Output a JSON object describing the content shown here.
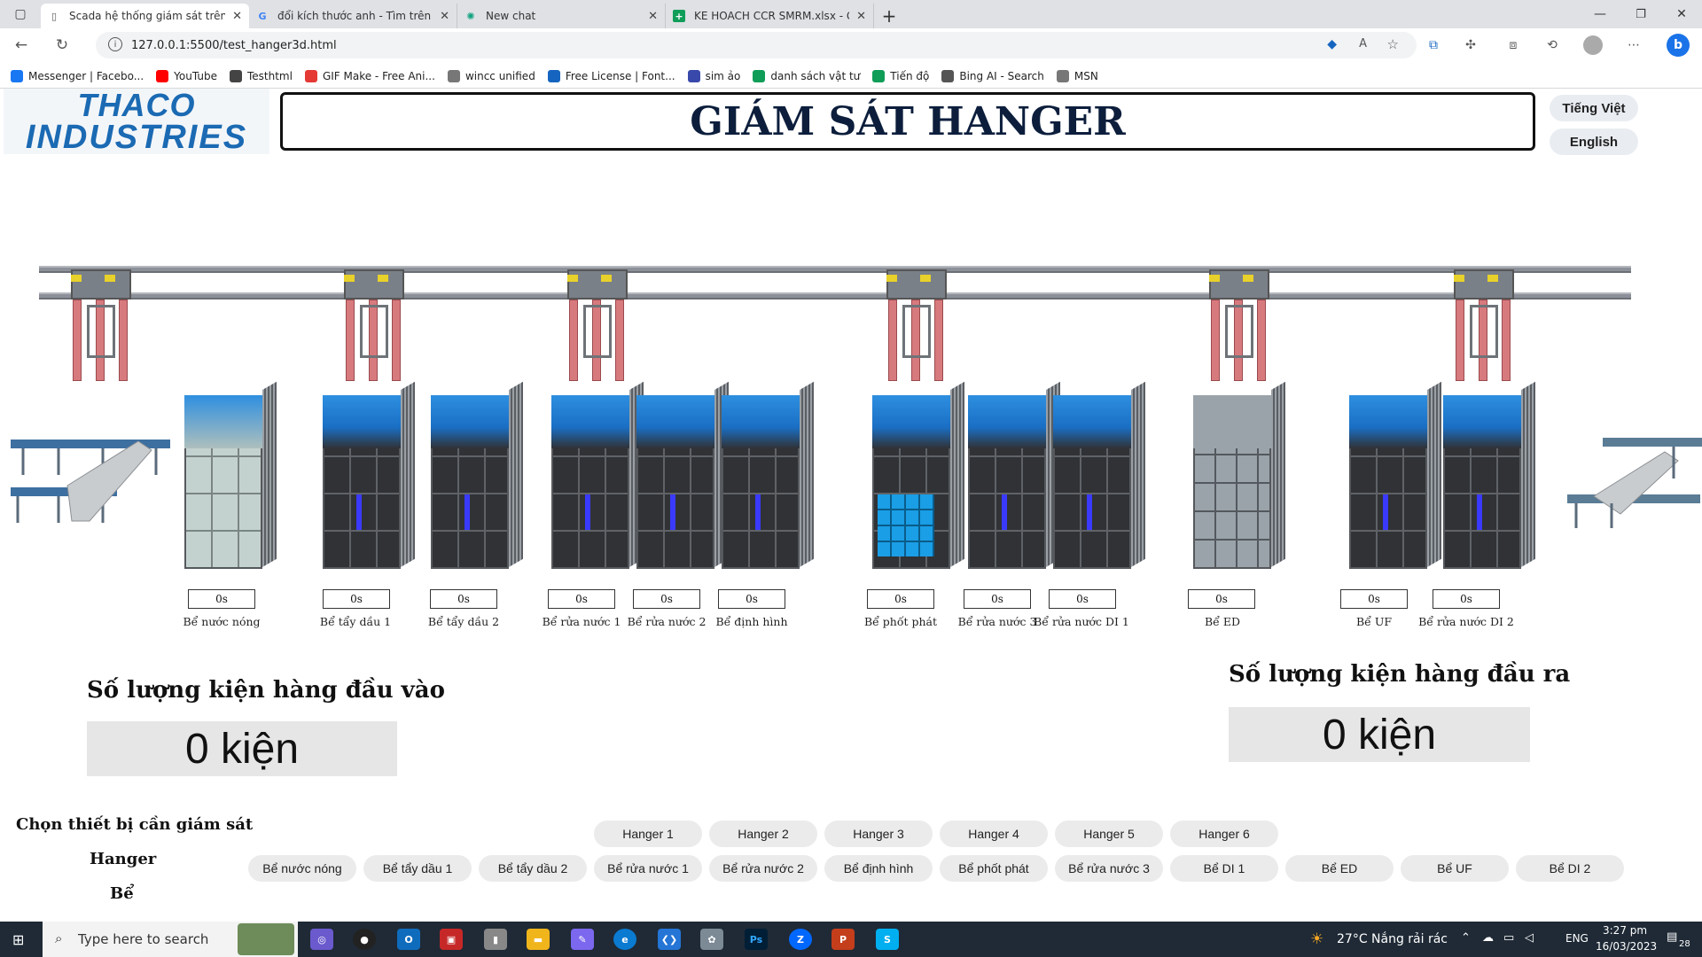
{
  "browser": {
    "tabs": [
      {
        "title": "Scada hệ thống giám sát trên int",
        "icon": "document-icon",
        "active": true
      },
      {
        "title": "đổi kích thước anh - Tìm trên Go",
        "icon": "google-icon",
        "active": false
      },
      {
        "title": "New chat",
        "icon": "chatgpt-icon",
        "active": false
      },
      {
        "title": "KE HOACH CCR SMRM.xlsx - Goo",
        "icon": "sheets-icon",
        "active": false
      }
    ],
    "url": "127.0.0.1:5500/test_hanger3d.html",
    "bookmarks": [
      {
        "label": "Messenger | Facebo...",
        "icon": "facebook-icon",
        "color": "#1877f2"
      },
      {
        "label": "YouTube",
        "icon": "youtube-icon",
        "color": "#ff0000"
      },
      {
        "label": "Testhtml",
        "icon": "gear-icon",
        "color": "#444444"
      },
      {
        "label": "GIF Make - Free Ani...",
        "icon": "gif-icon",
        "color": "#e53935"
      },
      {
        "label": "wincc unified",
        "icon": "page-icon",
        "color": "#777777"
      },
      {
        "label": "Free License | Font...",
        "icon": "flag-icon",
        "color": "#1565c0"
      },
      {
        "label": "sim ảo",
        "icon": "sms-icon",
        "color": "#3949ab"
      },
      {
        "label": "danh sách vật tư",
        "icon": "sheets-icon",
        "color": "#0f9d58"
      },
      {
        "label": "Tiến độ",
        "icon": "sheets-icon",
        "color": "#0f9d58"
      },
      {
        "label": "Bing AI - Search",
        "icon": "search-icon",
        "color": "#555555"
      },
      {
        "label": "MSN",
        "icon": "page-icon",
        "color": "#777777"
      }
    ]
  },
  "header": {
    "logo_line1": "THACO",
    "logo_line2": "INDUSTRIES",
    "title": "GIÁM SÁT HANGER",
    "lang_vi": "Tiếng Việt",
    "lang_en": "English"
  },
  "tanks": [
    {
      "label": "Bể nước nóng",
      "time": "0s"
    },
    {
      "label": "Bể tẩy dầu 1",
      "time": "0s"
    },
    {
      "label": "Bể tẩy dầu 2",
      "time": "0s"
    },
    {
      "label": "Bể rửa nước 1",
      "time": "0s"
    },
    {
      "label": "Bể rửa nước 2",
      "time": "0s"
    },
    {
      "label": "Bể định hình",
      "time": "0s"
    },
    {
      "label": "Bể phốt phát",
      "time": "0s"
    },
    {
      "label": "Bể rửa nước 3",
      "time": "0s"
    },
    {
      "label": "Bể rửa nước DI 1",
      "time": "0s"
    },
    {
      "label": "Bể ED",
      "time": "0s"
    },
    {
      "label": "Bể UF",
      "time": "0s"
    },
    {
      "label": "Bể rửa nước DI 2",
      "time": "0s"
    }
  ],
  "counters": {
    "input_title": "Số lượng kiện hàng đầu vào",
    "input_value": "0 kiện",
    "output_title": "Số lượng kiện hàng đầu ra",
    "output_value": "0 kiện"
  },
  "selection": {
    "title": "Chọn thiết bị cần giám sát",
    "hanger_label": "Hanger",
    "tank_label": "Bể",
    "hangers": [
      "Hanger 1",
      "Hanger 2",
      "Hanger 3",
      "Hanger 4",
      "Hanger 5",
      "Hanger 6"
    ],
    "tanks": [
      "Bể nước nóng",
      "Bể tẩy dầu 1",
      "Bể tẩy dầu 2",
      "Bể rửa nước 1",
      "Bể rửa nước 2",
      "Bể định hình",
      "Bể phốt phát",
      "Bể rửa nước 3",
      "Bể DI 1",
      "Bể ED",
      "Bể UF",
      "Bể DI 2"
    ]
  },
  "taskbar": {
    "search_placeholder": "Type here to search",
    "weather": "27°C  Nắng rải rác",
    "lang": "ENG",
    "time": "3:27 pm",
    "date": "16/03/2023",
    "notifications": "28"
  },
  "colors": {
    "title_text": "#0c1e3c",
    "logo_blue": "#1b6ab3",
    "tank_blue": "#1a6fc4",
    "hanger_leg": "#d77a7e",
    "taskbar": "#1f2a36"
  }
}
